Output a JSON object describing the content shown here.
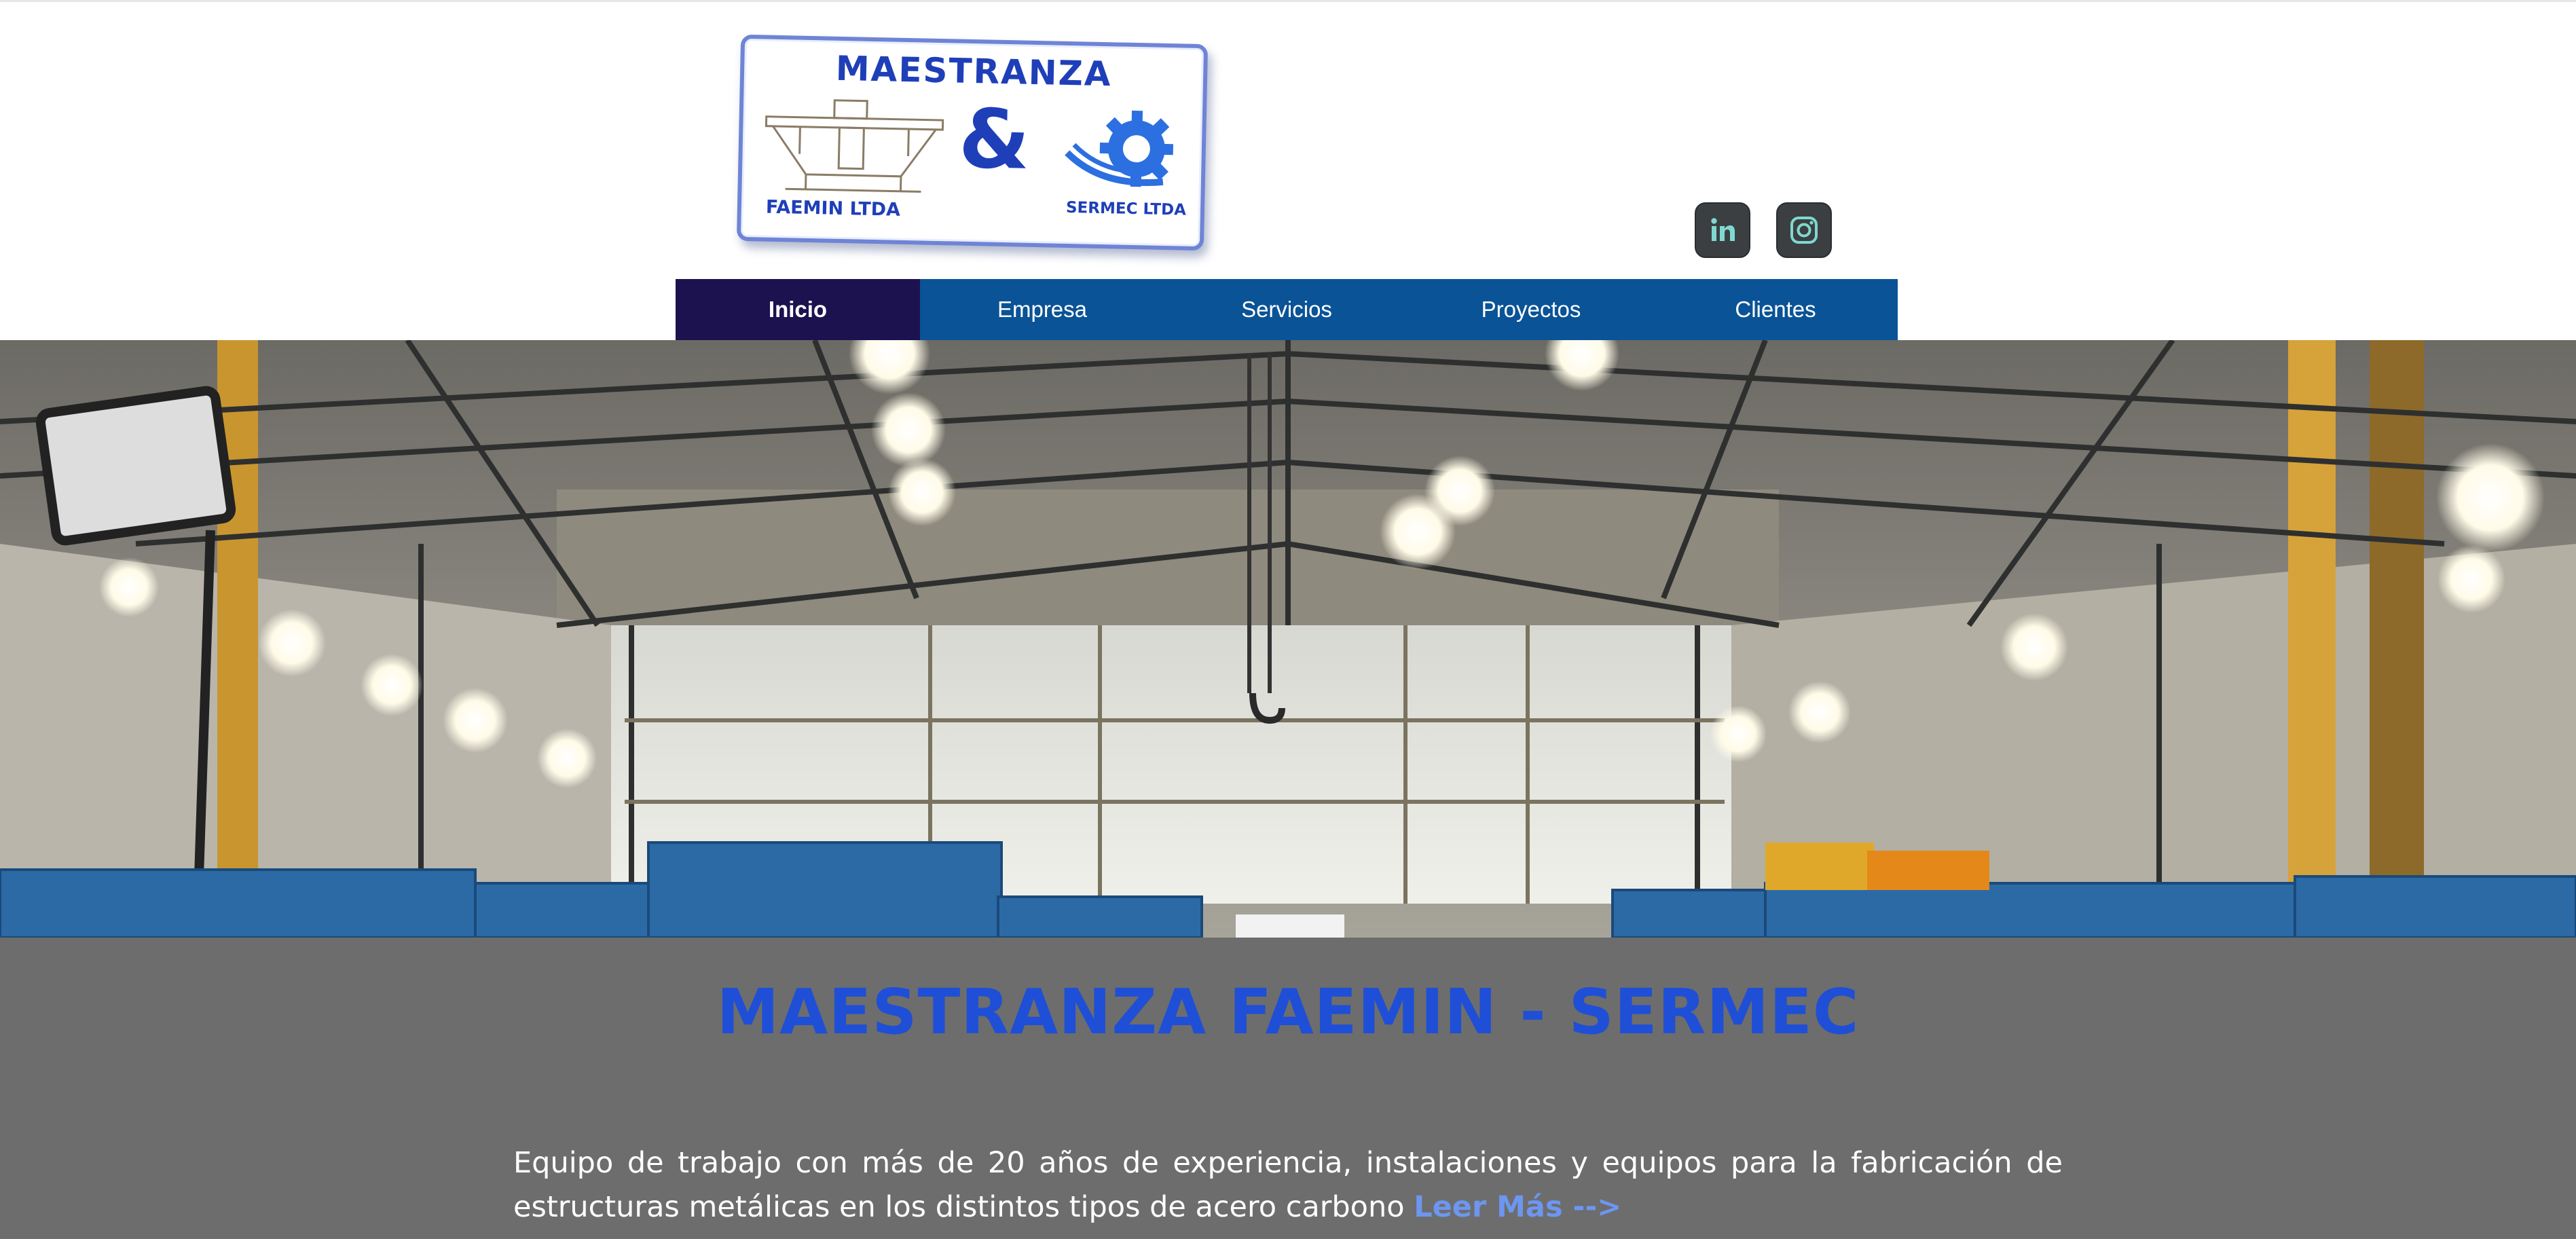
{
  "logo": {
    "title": "MAESTRANZA",
    "amp": "&",
    "left_company": "FAEMIN LTDA",
    "right_company": "SERMEC LTDA",
    "brand_color": "#1f3fb8"
  },
  "social": [
    {
      "icon": "linkedin-icon",
      "label": "in"
    },
    {
      "icon": "instagram-icon"
    }
  ],
  "nav": {
    "items": [
      {
        "label": "Inicio",
        "active": true
      },
      {
        "label": "Empresa",
        "active": false
      },
      {
        "label": "Servicios",
        "active": false
      },
      {
        "label": "Proyectos",
        "active": false
      },
      {
        "label": "Clientes",
        "active": false
      }
    ],
    "bar_color": "#0a5396",
    "active_color": "#1c1250"
  },
  "hero": {
    "image": "industrial-warehouse-photo"
  },
  "info": {
    "title": "MAESTRANZA FAEMIN - SERMEC",
    "body": "Equipo de trabajo con más de 20 años de experiencia, instalaciones y equipos para la fabricación de estructuras metálicas en los distintos tipos de acero carbono",
    "link_label": "Leer Más -->",
    "title_color": "#1f4fd6",
    "link_color": "#6d96f0",
    "background_color": "#6d6d6d"
  }
}
